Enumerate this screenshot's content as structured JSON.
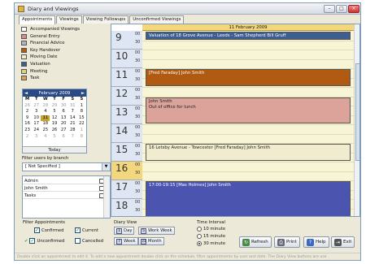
{
  "window": {
    "title": "Diary and Viewings",
    "min": "–",
    "max": "□",
    "close": "×"
  },
  "tabs": [
    "Appointments",
    "Viewings",
    "Viewing Followups",
    "Unconfirmed Viewings"
  ],
  "categories": [
    {
      "label": "Accompanied Viewings",
      "color": "#ffffff"
    },
    {
      "label": "General Entry",
      "color": "#d98b88"
    },
    {
      "label": "Financial Advice",
      "color": "#b2b2c2"
    },
    {
      "label": "Key Handover",
      "color": "#b05a12"
    },
    {
      "label": "Moving Date",
      "color": "#f1ecd0"
    },
    {
      "label": "Valuation",
      "color": "#3d5e8f"
    },
    {
      "label": "Meeting",
      "color": "#d8d27a"
    },
    {
      "label": "Task",
      "color": "#d8a25e"
    }
  ],
  "calendar": {
    "month": "February 2009",
    "prev": "◄",
    "next": "►",
    "dow": [
      "M",
      "T",
      "W",
      "T",
      "F",
      "S",
      "S"
    ],
    "weeks": [
      [
        "26",
        "27",
        "28",
        "29",
        "30",
        "31",
        "1"
      ],
      [
        "2",
        "3",
        "4",
        "5",
        "6",
        "7",
        "8"
      ],
      [
        "9",
        "10",
        "11",
        "12",
        "13",
        "14",
        "15"
      ],
      [
        "16",
        "17",
        "18",
        "19",
        "20",
        "21",
        "22"
      ],
      [
        "23",
        "24",
        "25",
        "26",
        "27",
        "28",
        "1"
      ],
      [
        "2",
        "3",
        "4",
        "5",
        "6",
        "7",
        "8"
      ]
    ],
    "today": "Today"
  },
  "filter_branch": {
    "label": "Filter users by branch",
    "value": "[ Not Specified ]",
    "arrow": "▼"
  },
  "users": [
    "Admin",
    "John Smith",
    "Tasks"
  ],
  "schedule": {
    "date": "11 February 2009",
    "hours": [
      "9",
      "10",
      "11",
      "12",
      "13",
      "14",
      "15",
      "16",
      "17",
      "18"
    ],
    "m00": "00",
    "m30": "30",
    "appointments": [
      {
        "text": "Valuation of 18 Grove Avenue - Leeds - Sam Shepherd Bill Gruff",
        "color": "#3d5e8f",
        "fg": "#ffffff",
        "start": 0,
        "slots": 1
      },
      {
        "text": "[Fred Faraday] John Smith",
        "color": "#b05a12",
        "fg": "#ffffff",
        "start": 4,
        "slots": 2
      },
      {
        "text": "John Smith\nOut of office for lunch",
        "color": "#dca39a",
        "fg": "#222222",
        "start": 7,
        "slots": 3
      },
      {
        "text": "16 Letsby Avenue - Towcester [Fred Faraday] John Smith",
        "color": "#f1ecd0",
        "fg": "#222222",
        "start": 12,
        "slots": 2
      },
      {
        "text": "17:00-19:15  [Mas Holmes] John Smith",
        "color": "#4b55b0",
        "fg": "#ffffff",
        "start": 16,
        "slots": 5
      }
    ]
  },
  "filter_appointments": {
    "label": "Filter Appointments",
    "confirmed": "Confirmed",
    "current": "Current",
    "unconfirmed": "Unconfirmed",
    "cancelled": "Cancelled"
  },
  "diary_view": {
    "label": "Diary View",
    "day": "Day",
    "work_week": "Work Week",
    "week": "Week",
    "month": "Month",
    "day_icon": "1",
    "work_week_icon": "5",
    "week_icon": "7",
    "month_icon": "31"
  },
  "time_interval": {
    "label": "Time Interval",
    "options": [
      "10 minute",
      "15 minute",
      "30 minute"
    ]
  },
  "actions": {
    "refresh": "Refresh",
    "print": "Print",
    "help": "Help",
    "exit": "Exit"
  },
  "status": "Double click an appointment to edit it. To add a new appointment double click on the schedule, filter appointments by user and date. The Diary View buttons are use"
}
